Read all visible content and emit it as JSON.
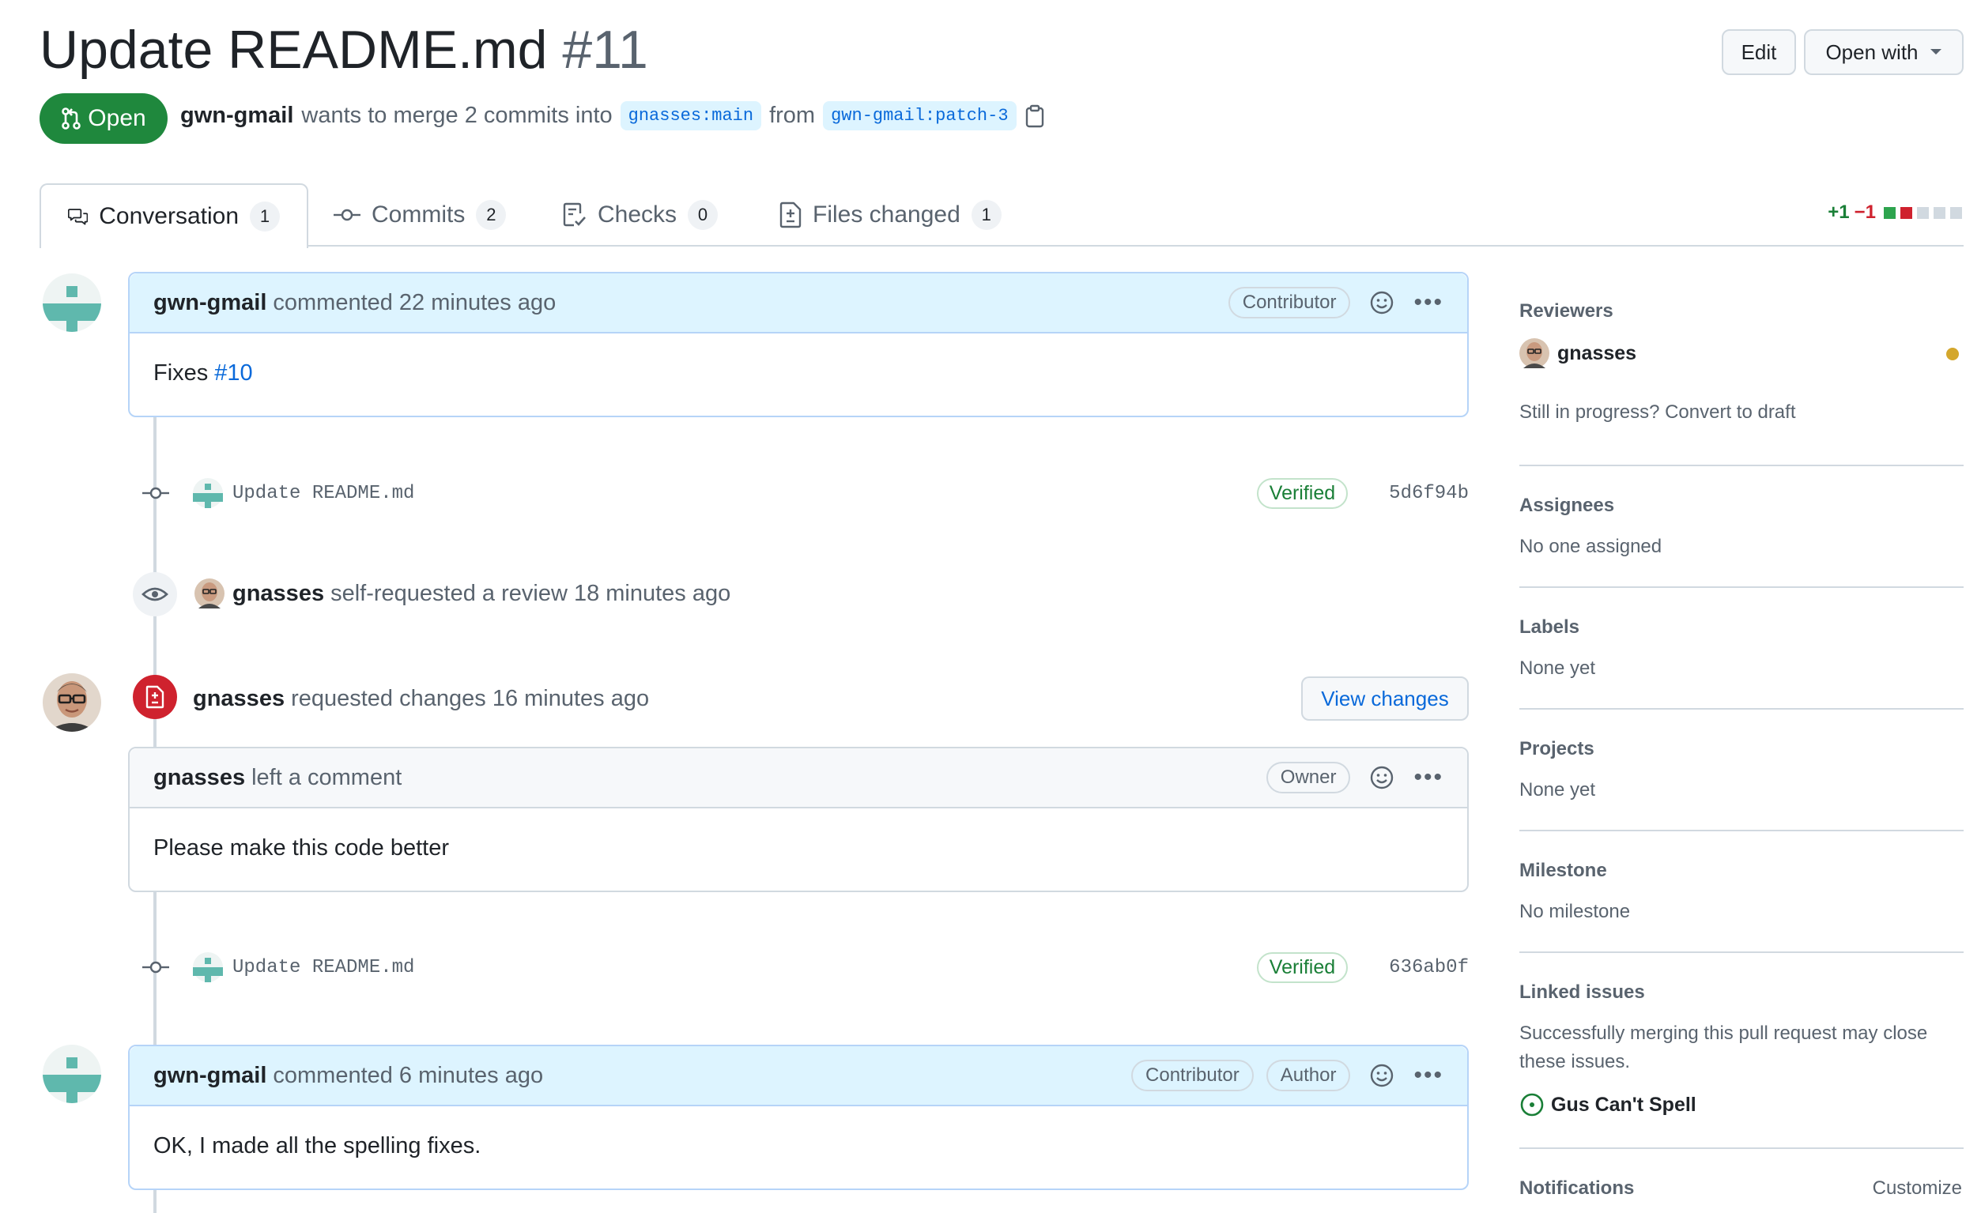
{
  "header": {
    "title": "Update README.md",
    "number": "#11",
    "edit_label": "Edit",
    "open_with_label": "Open with",
    "state": "Open",
    "author": "gwn-gmail",
    "merge_text": "wants to merge 2 commits into",
    "base_branch": "gnasses:main",
    "from_text": "from",
    "head_branch": "gwn-gmail:patch-3"
  },
  "tabs": [
    {
      "label": "Conversation",
      "count": "1"
    },
    {
      "label": "Commits",
      "count": "2"
    },
    {
      "label": "Checks",
      "count": "0"
    },
    {
      "label": "Files changed",
      "count": "1"
    }
  ],
  "diffstat": {
    "additions": "+1",
    "deletions": "−1"
  },
  "timeline": {
    "comment1": {
      "author": "gwn-gmail",
      "action": "commented",
      "time": "22 minutes ago",
      "role": "Contributor",
      "body_text": "Fixes",
      "body_link": "#10"
    },
    "commit1": {
      "message": "Update README.md",
      "verified": "Verified",
      "sha": "5d6f94b"
    },
    "review_request": {
      "author": "gnasses",
      "text": "self-requested a review 18 minutes ago"
    },
    "review": {
      "author": "gnasses",
      "text": "requested changes 16 minutes ago",
      "button": "View changes"
    },
    "review_comment": {
      "author": "gnasses",
      "action": "left a comment",
      "role": "Owner",
      "body": "Please make this code better"
    },
    "commit2": {
      "message": "Update README.md",
      "verified": "Verified",
      "sha": "636ab0f"
    },
    "comment2": {
      "author": "gwn-gmail",
      "action": "commented",
      "time": "6 minutes ago",
      "role1": "Contributor",
      "role2": "Author",
      "body": "OK, I made all the spelling fixes."
    }
  },
  "sidebar": {
    "reviewers_heading": "Reviewers",
    "reviewer_name": "gnasses",
    "draft_text": "Still in progress? Convert to draft",
    "assignees_heading": "Assignees",
    "assignees_value": "No one assigned",
    "labels_heading": "Labels",
    "labels_value": "None yet",
    "projects_heading": "Projects",
    "projects_value": "None yet",
    "milestone_heading": "Milestone",
    "milestone_value": "No milestone",
    "linked_heading": "Linked issues",
    "linked_text_1": "Successfully merging this pull request may close",
    "linked_text_2": "these issues.",
    "linked_issue": "Gus Can't Spell",
    "notifications_heading": "Notifications",
    "customize_label": "Customize"
  },
  "colors": {
    "open_green": "#1f883d",
    "link_blue": "#0969da",
    "danger_red": "#cf222e",
    "pending_yellow": "#d4a72c"
  }
}
